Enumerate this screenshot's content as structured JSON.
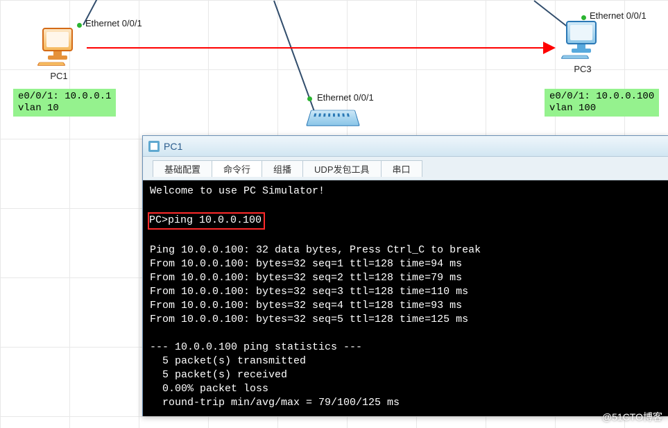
{
  "topology": {
    "pc1": {
      "name": "PC1",
      "port": "Ethernet 0/0/1",
      "info_line1": "e0/0/1: 10.0.0.1",
      "info_line2": "vlan 10"
    },
    "pc3": {
      "name": "PC3",
      "port": "Ethernet 0/0/1",
      "info_line1": "e0/0/1: 10.0.0.100",
      "info_line2": "vlan 100"
    },
    "switch": {
      "port": "Ethernet 0/0/1"
    }
  },
  "terminalWindow": {
    "title": "PC1",
    "tabs": {
      "basic": "基础配置",
      "cmd": "命令行",
      "multicast": "组播",
      "udp": "UDP发包工具",
      "serial": "串口"
    }
  },
  "terminal": {
    "welcome": "Welcome to use PC Simulator!",
    "prompt": "PC>",
    "command": "ping 10.0.0.100",
    "header": "Ping 10.0.0.100: 32 data bytes, Press Ctrl_C to break",
    "replies": [
      "From 10.0.0.100: bytes=32 seq=1 ttl=128 time=94 ms",
      "From 10.0.0.100: bytes=32 seq=2 ttl=128 time=79 ms",
      "From 10.0.0.100: bytes=32 seq=3 ttl=128 time=110 ms",
      "From 10.0.0.100: bytes=32 seq=4 ttl=128 time=93 ms",
      "From 10.0.0.100: bytes=32 seq=5 ttl=128 time=125 ms"
    ],
    "stats_header": "--- 10.0.0.100 ping statistics ---",
    "stats": [
      "  5 packet(s) transmitted",
      "  5 packet(s) received",
      "  0.00% packet loss",
      "  round-trip min/avg/max = 79/100/125 ms"
    ]
  },
  "watermark": "@51CTO博客"
}
